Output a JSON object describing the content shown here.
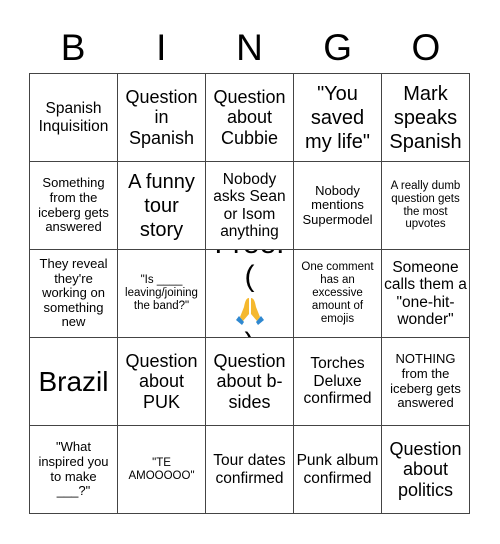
{
  "header": {
    "letters": [
      "B",
      "I",
      "N",
      "G",
      "O"
    ]
  },
  "board": {
    "rows": [
      [
        {
          "text": "Spanish Inquisition"
        },
        {
          "text": "Question in Spanish"
        },
        {
          "text": "Question about Cubbie"
        },
        {
          "text": "\"You saved my life\""
        },
        {
          "text": "Mark speaks Spanish"
        }
      ],
      [
        {
          "text": "Something from the iceberg gets answered"
        },
        {
          "text": "A funny tour story"
        },
        {
          "text": "Nobody asks Sean or Isom anything"
        },
        {
          "text": "Nobody mentions Supermodel"
        },
        {
          "text": "A really dumb question gets the most upvotes"
        }
      ],
      [
        {
          "text": "They reveal they're working on something new"
        },
        {
          "text": "\"Is ____ leaving/joining the band?\""
        },
        {
          "text": "Free!",
          "icon": "praying-hands-icon",
          "icon_wrap": [
            "(",
            ")"
          ]
        },
        {
          "text": "One comment has an excessive amount of emojis"
        },
        {
          "text": "Someone calls them a \"one-hit-wonder\""
        }
      ],
      [
        {
          "text": "Brazil"
        },
        {
          "text": "Question about PUK"
        },
        {
          "text": "Question about b-sides"
        },
        {
          "text": "Torches Deluxe confirmed"
        },
        {
          "text": "NOTHING from the iceberg gets answered"
        }
      ],
      [
        {
          "text": "\"What inspired you to make ___?\""
        },
        {
          "text": "\"TE AMOOOOO\""
        },
        {
          "text": "Tour dates confirmed"
        },
        {
          "text": "Punk album confirmed"
        },
        {
          "text": "Question about politics"
        }
      ]
    ]
  },
  "colors": {
    "grid_line": "#444444",
    "text": "#000000",
    "background": "#ffffff",
    "emoji_yellow": "#f5b82e",
    "emoji_blue": "#2f88d0"
  }
}
